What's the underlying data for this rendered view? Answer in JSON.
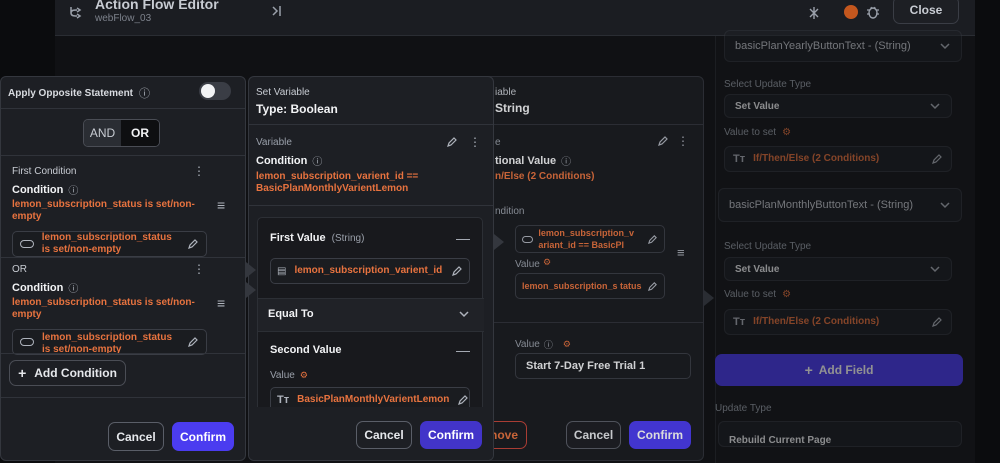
{
  "header": {
    "title": "Action Flow Editor",
    "subtitle": "webFlow_03",
    "close_label": "Close"
  },
  "right_panel": {
    "field1_name": "basicPlanYearlyButtonText - (String)",
    "select_update_type_label": "Select Update Type",
    "set_value_label": "Set Value",
    "value_to_set_label": "Value to set",
    "field1_value": "If/Then/Else (2 Conditions)",
    "field2_name": "basicPlanMonthlyButtonText - (String)",
    "field2_value": "If/Then/Else (2 Conditions)",
    "add_field_label": "Add Field",
    "update_type_label": "Update Type",
    "update_type_value": "Rebuild Current Page"
  },
  "middle_back": {
    "header_fragment": "iable",
    "type_fragment": "String",
    "var_fragment": "e",
    "title_fragment": "tional Value",
    "subtitle_fragment": "n/Else (2 Conditions)",
    "cond_fragment": "ndition",
    "chip1": "lemon_subscription_v ariant_id == BasicPl",
    "value_label": "Value",
    "chip2": "lemon_subscription_s tatus",
    "value2_label": "Value",
    "start_trial": "Start 7-Day Free Trial 1",
    "cancel_label": "Cancel",
    "confirm_label": "Confirm",
    "remove_fragment": "nove"
  },
  "set_variable": {
    "header": "Set Variable",
    "type": "Type: Boolean",
    "variable_label": "Variable",
    "condition_title": "Condition",
    "condition_expr": "lemon_subscription_varient_id == BasicPlanMonthlyVarientLemon",
    "first_value_label": "First Value",
    "first_value_type": "(String)",
    "first_value_chip": "lemon_subscription_varient_id",
    "equal_to_label": "Equal To",
    "second_value_label": "Second Value",
    "value_label": "Value",
    "second_value_chip": "BasicPlanMonthlyVarientLemon",
    "cancel_label": "Cancel",
    "confirm_label": "Confirm"
  },
  "conditions_panel": {
    "apply_opposite_label": "Apply Opposite Statement",
    "and_label": "AND",
    "or_label": "OR",
    "first_condition_label": "First Condition",
    "condition_title": "Condition",
    "condition1_expr": "lemon_subscription_status is set/non-empty",
    "condition1_chip": "lemon_subscription_status is set/non-empty",
    "or_divider": "OR",
    "condition2_expr": "lemon_subscription_status is set/non-empty",
    "condition2_chip": "lemon_subscription_status is set/non-empty",
    "add_condition_label": "Add Condition",
    "cancel_label": "Cancel",
    "confirm_label": "Confirm"
  },
  "colors": {
    "accent": "#4b3cf0",
    "orange": "#e8733f",
    "panel": "#1d1f24"
  }
}
